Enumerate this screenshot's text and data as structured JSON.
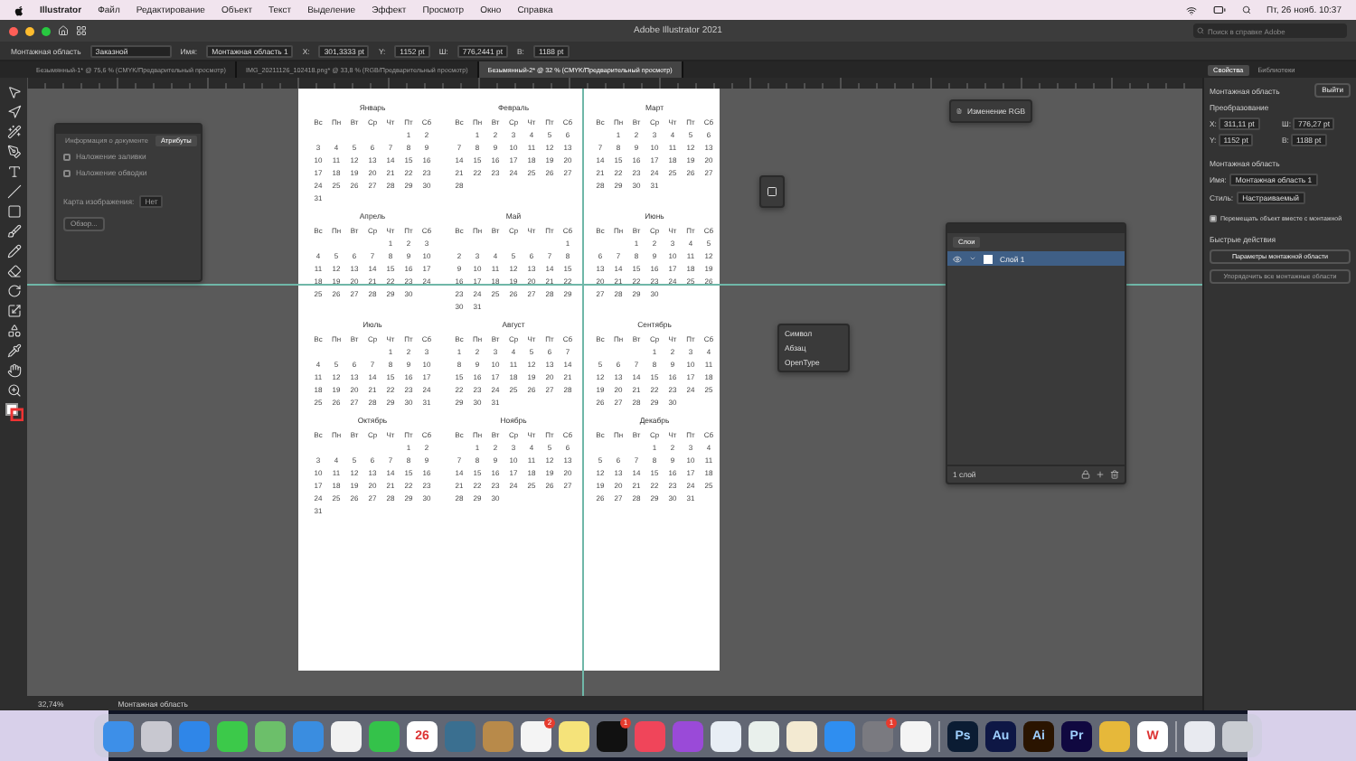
{
  "menu_bar": {
    "app": "Illustrator",
    "items": [
      "Файл",
      "Редактирование",
      "Объект",
      "Текст",
      "Выделение",
      "Эффект",
      "Просмотр",
      "Окно",
      "Справка"
    ],
    "clock": "Пт, 26 нояб. 10:37"
  },
  "window": {
    "title": "Adobe Illustrator 2021",
    "search": {
      "placeholder": "Поиск в справке Adobe"
    }
  },
  "control_bar": {
    "context": "Монтажная область",
    "preset": "Заказной",
    "name_label": "Имя:",
    "name": "Монтажная область 1",
    "fields": [
      {
        "label": "X:",
        "value": "301,3333 pt"
      },
      {
        "label": "Y:",
        "value": "1152 pt"
      },
      {
        "label": "Ш:",
        "value": "776,2441 pt"
      },
      {
        "label": "В:",
        "value": "1188 pt"
      }
    ]
  },
  "tabs": [
    {
      "label": "Безымянный-1* @ 75,6 % (CMYK/Предварительный просмотр)",
      "selected": false
    },
    {
      "label": "IMG_20211126_102418.png* @ 33,8 % (RGB/Предварительный просмотр)",
      "selected": false
    },
    {
      "label": "Безымянный-2* @ 32 % (CMYK/Предварительный просмотр)",
      "selected": true
    }
  ],
  "attributes_panel": {
    "tabs": [
      {
        "label": "Информация о документе",
        "selected": false
      },
      {
        "label": "Атрибуты",
        "selected": true
      }
    ],
    "options": [
      {
        "label": "Наложение заливки",
        "checked": false
      },
      {
        "label": "Наложение обводки",
        "checked": false
      }
    ],
    "url_label": "Карта изображения:",
    "url_value": "Нет",
    "button": "Обзор..."
  },
  "type_popup": {
    "items": [
      "Символ",
      "Абзац",
      "OpenType"
    ]
  },
  "color_panel": {
    "label": "Изменение RGB"
  },
  "calendar": {
    "months": [
      {
        "name": "Январь",
        "weekdays": [
          "Вс",
          "Пн",
          "Вт",
          "Ср",
          "Чт",
          "Пт",
          "Сб"
        ],
        "weeks": [
          [
            "1",
            "2"
          ],
          [
            "3",
            "4",
            "5",
            "6",
            "7",
            "8",
            "9"
          ],
          [
            "10",
            "11",
            "12",
            "13",
            "14",
            "15",
            "16"
          ],
          [
            "17",
            "18",
            "19",
            "20",
            "21",
            "22",
            "23"
          ],
          [
            "24",
            "25",
            "26",
            "27",
            "28",
            "29",
            "30"
          ],
          [
            "31"
          ]
        ]
      },
      {
        "name": "Февраль",
        "weekdays": [
          "Вс",
          "Пн",
          "Вт",
          "Ср",
          "Чт",
          "Пт",
          "Сб"
        ],
        "weeks": [
          [
            "1",
            "2",
            "3",
            "4",
            "5",
            "6"
          ],
          [
            "7",
            "8",
            "9",
            "10",
            "11",
            "12",
            "13"
          ],
          [
            "14",
            "15",
            "16",
            "17",
            "18",
            "19",
            "20"
          ],
          [
            "21",
            "22",
            "23",
            "24",
            "25",
            "26",
            "27"
          ],
          [
            "28"
          ]
        ]
      },
      {
        "name": "Март",
        "weekdays": [
          "Вс",
          "Пн",
          "Вт",
          "Ср",
          "Чт",
          "Пт",
          "Сб"
        ],
        "weeks": [
          [
            "1",
            "2",
            "3",
            "4",
            "5",
            "6"
          ],
          [
            "7",
            "8",
            "9",
            "10",
            "11",
            "12",
            "13"
          ],
          [
            "14",
            "15",
            "16",
            "17",
            "18",
            "19",
            "20"
          ],
          [
            "21",
            "22",
            "23",
            "24",
            "25",
            "26",
            "27"
          ],
          [
            "28",
            "29",
            "30",
            "31"
          ]
        ]
      },
      {
        "name": "Апрель",
        "weekdays": [
          "Вс",
          "Пн",
          "Вт",
          "Ср",
          "Чт",
          "Пт",
          "Сб"
        ],
        "weeks": [
          [
            "1",
            "2",
            "3"
          ],
          [
            "4",
            "5",
            "6",
            "7",
            "8",
            "9",
            "10"
          ],
          [
            "11",
            "12",
            "13",
            "14",
            "15",
            "16",
            "17"
          ],
          [
            "18",
            "19",
            "20",
            "21",
            "22",
            "23",
            "24"
          ],
          [
            "25",
            "26",
            "27",
            "28",
            "29",
            "30"
          ]
        ]
      },
      {
        "name": "Май",
        "weekdays": [
          "Вс",
          "Пн",
          "Вт",
          "Ср",
          "Чт",
          "Пт",
          "Сб"
        ],
        "weeks": [
          [
            "1"
          ],
          [
            "2",
            "3",
            "4",
            "5",
            "6",
            "7",
            "8"
          ],
          [
            "9",
            "10",
            "11",
            "12",
            "13",
            "14",
            "15"
          ],
          [
            "16",
            "17",
            "18",
            "19",
            "20",
            "21",
            "22"
          ],
          [
            "23",
            "24",
            "25",
            "26",
            "27",
            "28",
            "29"
          ],
          [
            "30",
            "31"
          ]
        ]
      },
      {
        "name": "Июнь",
        "weekdays": [
          "Вс",
          "Пн",
          "Вт",
          "Ср",
          "Чт",
          "Пт",
          "Сб"
        ],
        "weeks": [
          [
            "1",
            "2",
            "3",
            "4",
            "5"
          ],
          [
            "6",
            "7",
            "8",
            "9",
            "10",
            "11",
            "12"
          ],
          [
            "13",
            "14",
            "15",
            "16",
            "17",
            "18",
            "19"
          ],
          [
            "20",
            "21",
            "22",
            "23",
            "24",
            "25",
            "26"
          ],
          [
            "27",
            "28",
            "29",
            "30"
          ]
        ]
      },
      {
        "name": "Июль",
        "weekdays": [
          "Вс",
          "Пн",
          "Вт",
          "Ср",
          "Чт",
          "Пт",
          "Сб"
        ],
        "weeks": [
          [
            "1",
            "2",
            "3"
          ],
          [
            "4",
            "5",
            "6",
            "7",
            "8",
            "9",
            "10"
          ],
          [
            "11",
            "12",
            "13",
            "14",
            "15",
            "16",
            "17"
          ],
          [
            "18",
            "19",
            "20",
            "21",
            "22",
            "23",
            "24"
          ],
          [
            "25",
            "26",
            "27",
            "28",
            "29",
            "30",
            "31"
          ]
        ]
      },
      {
        "name": "Август",
        "weekdays": [
          "Вс",
          "Пн",
          "Вт",
          "Ср",
          "Чт",
          "Пт",
          "Сб"
        ],
        "weeks": [
          [
            "1",
            "2",
            "3",
            "4",
            "5",
            "6",
            "7"
          ],
          [
            "8",
            "9",
            "10",
            "11",
            "12",
            "13",
            "14"
          ],
          [
            "15",
            "16",
            "17",
            "18",
            "19",
            "20",
            "21"
          ],
          [
            "22",
            "23",
            "24",
            "25",
            "26",
            "27",
            "28"
          ],
          [
            "29",
            "30",
            "31"
          ]
        ]
      },
      {
        "name": "Сентябрь",
        "weekdays": [
          "Вс",
          "Пн",
          "Вт",
          "Ср",
          "Чт",
          "Пт",
          "Сб"
        ],
        "weeks": [
          [
            "1",
            "2",
            "3",
            "4"
          ],
          [
            "5",
            "6",
            "7",
            "8",
            "9",
            "10",
            "11"
          ],
          [
            "12",
            "13",
            "14",
            "15",
            "16",
            "17",
            "18"
          ],
          [
            "19",
            "20",
            "21",
            "22",
            "23",
            "24",
            "25"
          ],
          [
            "26",
            "27",
            "28",
            "29",
            "30"
          ]
        ]
      },
      {
        "name": "Октябрь",
        "weekdays": [
          "Вс",
          "Пн",
          "Вт",
          "Ср",
          "Чт",
          "Пт",
          "Сб"
        ],
        "weeks": [
          [
            "1",
            "2"
          ],
          [
            "3",
            "4",
            "5",
            "6",
            "7",
            "8",
            "9"
          ],
          [
            "10",
            "11",
            "12",
            "13",
            "14",
            "15",
            "16"
          ],
          [
            "17",
            "18",
            "19",
            "20",
            "21",
            "22",
            "23"
          ],
          [
            "24",
            "25",
            "26",
            "27",
            "28",
            "29",
            "30"
          ],
          [
            "31"
          ]
        ]
      },
      {
        "name": "Ноябрь",
        "weekdays": [
          "Вс",
          "Пн",
          "Вт",
          "Ср",
          "Чт",
          "Пт",
          "Сб"
        ],
        "weeks": [
          [
            "1",
            "2",
            "3",
            "4",
            "5",
            "6"
          ],
          [
            "7",
            "8",
            "9",
            "10",
            "11",
            "12",
            "13"
          ],
          [
            "14",
            "15",
            "16",
            "17",
            "18",
            "19",
            "20"
          ],
          [
            "21",
            "22",
            "23",
            "24",
            "25",
            "26",
            "27"
          ],
          [
            "28",
            "29",
            "30"
          ]
        ]
      },
      {
        "name": "Декабрь",
        "weekdays": [
          "Вс",
          "Пн",
          "Вт",
          "Ср",
          "Чт",
          "Пт",
          "Сб"
        ],
        "weeks": [
          [
            "1",
            "2",
            "3",
            "4"
          ],
          [
            "5",
            "6",
            "7",
            "8",
            "9",
            "10",
            "11"
          ],
          [
            "12",
            "13",
            "14",
            "15",
            "16",
            "17",
            "18"
          ],
          [
            "19",
            "20",
            "21",
            "22",
            "23",
            "24",
            "25"
          ],
          [
            "26",
            "27",
            "28",
            "29",
            "30",
            "31"
          ]
        ]
      }
    ]
  },
  "layers_panel": {
    "title": "Слои",
    "layers": [
      {
        "name": "Слой 1",
        "selected": true,
        "visible": true
      }
    ],
    "footer": "1 слой"
  },
  "properties_panel": {
    "tabs": [
      {
        "label": "Свойства",
        "selected": true
      },
      {
        "label": "Библиотеки",
        "selected": false
      }
    ],
    "section_title": "Монтажная область",
    "exit_button": "Выйти",
    "transform_title": "Преобразование",
    "fields": [
      {
        "label": "X:",
        "value": "311,11 pt"
      },
      {
        "label": "Ш:",
        "value": "776,27 pt"
      },
      {
        "label": "Y:",
        "value": "1152 pt"
      },
      {
        "label": "В:",
        "value": "1188 pt"
      }
    ],
    "artboard_title": "Монтажная область",
    "name_label": "Имя:",
    "name": "Монтажная область 1",
    "style_label": "Стиль:",
    "style": "Настраиваемый",
    "move_option": {
      "label": "Перемещать объект вместе с монтажной",
      "checked": true
    },
    "quick_actions_title": "Быстрые действия",
    "buttons": [
      {
        "label": "Параметры монтажной области",
        "disabled": false
      },
      {
        "label": "Упорядочить все монтажные области",
        "disabled": true
      }
    ]
  },
  "status_bar": {
    "zoom": "32,74%",
    "artboard": "Монтажная область"
  },
  "dock": {
    "apps": [
      {
        "kind": "app",
        "color": "#3d8fe8"
      },
      {
        "kind": "app",
        "color": "#c8c8d0"
      },
      {
        "kind": "app",
        "color": "#2f86e8"
      },
      {
        "kind": "app",
        "color": "#3cc94a"
      },
      {
        "kind": "app",
        "color": "#6cbf6a"
      },
      {
        "kind": "app",
        "color": "#3a8de0"
      },
      {
        "kind": "app",
        "color": "#f2f2f2"
      },
      {
        "kind": "app",
        "color": "#34c24a"
      },
      {
        "kind": "app",
        "color": "#ffffff",
        "label": "26"
      },
      {
        "kind": "app",
        "color": "#3a6f90"
      },
      {
        "kind": "app",
        "color": "#b88a4a"
      },
      {
        "kind": "app",
        "color": "#f4f4f4",
        "badge": "2"
      },
      {
        "kind": "app",
        "color": "#f5e37a"
      },
      {
        "kind": "app",
        "color": "#111111",
        "badge": "1"
      },
      {
        "kind": "app",
        "color": "#f0455a"
      },
      {
        "kind": "app",
        "color": "#9a4ad8"
      },
      {
        "kind": "app",
        "color": "#e8eef5"
      },
      {
        "kind": "app",
        "color": "#e9f0ec"
      },
      {
        "kind": "app",
        "color": "#f3ead2"
      },
      {
        "kind": "app",
        "color": "#2f8ef0"
      },
      {
        "kind": "app",
        "color": "#7a7a80",
        "badge": "1"
      },
      {
        "kind": "app",
        "color": "#f4f4f4"
      },
      {
        "kind": "separator"
      },
      {
        "kind": "app",
        "color": "#0b1c33",
        "label": "Ps"
      },
      {
        "kind": "app",
        "color": "#0e1745",
        "label": "Au"
      },
      {
        "kind": "app",
        "color": "#2a1400",
        "label": "Ai"
      },
      {
        "kind": "app",
        "color": "#100840",
        "label": "Pr"
      },
      {
        "kind": "app",
        "color": "#e6b83a"
      },
      {
        "kind": "app",
        "color": "#ffffff",
        "label": "W"
      },
      {
        "kind": "separator"
      },
      {
        "kind": "app",
        "color": "#e8eaf0"
      },
      {
        "kind": "app",
        "color": "#c9ccd2"
      }
    ]
  }
}
